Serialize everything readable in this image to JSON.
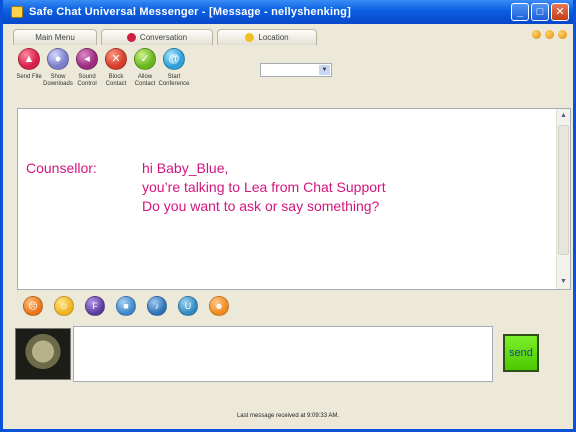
{
  "window": {
    "title": "Safe Chat Universal Messenger - [Message - nellyshenking]"
  },
  "window_buttons": {
    "minimize": "_",
    "maximize": "□",
    "close": "✕"
  },
  "tabs": [
    {
      "label": "Main Menu"
    },
    {
      "label": "Conversation"
    },
    {
      "label": "Location"
    }
  ],
  "toolbar": [
    {
      "label": "Send File",
      "icon": "send-file-icon",
      "color": "#d6204d",
      "glyph": "▲"
    },
    {
      "label": "Show Downloads",
      "icon": "downloads-icon",
      "color": "#7b7ec9",
      "glyph": "●"
    },
    {
      "label": "Sound Control",
      "icon": "sound-icon",
      "color": "#9b2d7f",
      "glyph": "◂"
    },
    {
      "label": "Block Contact",
      "icon": "block-icon",
      "color": "#d43d2a",
      "glyph": "✕"
    },
    {
      "label": "Allow Contact",
      "icon": "allow-icon",
      "color": "#6ab61f",
      "glyph": "✓"
    },
    {
      "label": "Start Conference",
      "icon": "conference-icon",
      "color": "#2e9fd8",
      "glyph": "@"
    }
  ],
  "conversation": {
    "sender": "Counsellor:",
    "lines": [
      "hi Baby_Blue,",
      "you’re talking to Lea from Chat Support",
      "Do you want to ask or say something?"
    ]
  },
  "emoticons": [
    {
      "icon": "angry-smiley-icon",
      "color": "#e8741a"
    },
    {
      "icon": "happy-smiley-icon",
      "color": "#f0b21e"
    },
    {
      "icon": "purple-emote-icon",
      "color": "#5b3b9b"
    },
    {
      "icon": "square-emote-icon",
      "color": "#3f86c9"
    },
    {
      "icon": "blue-emote-icon",
      "color": "#2d72b8"
    },
    {
      "icon": "teal-emote-icon",
      "color": "#2f88c0"
    },
    {
      "icon": "orange-emote-icon",
      "color": "#f08a1e"
    }
  ],
  "send_label": "send",
  "status": "Last message received at 9:09:33 AM."
}
